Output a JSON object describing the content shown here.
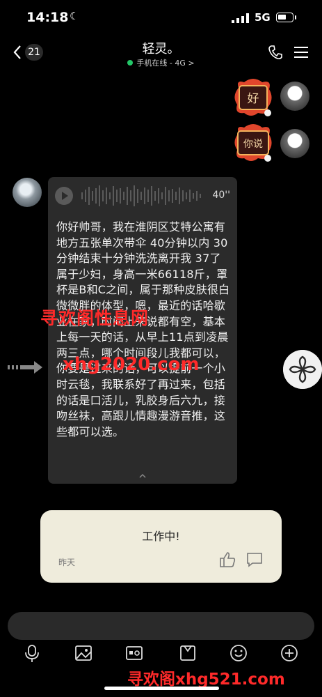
{
  "status": {
    "time": "14:18",
    "network": "5G"
  },
  "header": {
    "unread_count": "21",
    "title": "轻灵。",
    "subtitle": "手机在线 - 4G >"
  },
  "messages": {
    "sticker_1_text": "好",
    "sticker_2_text": "你说",
    "voice_duration": "40''",
    "transcript": "你好帅哥，我在淮阴区艾特公寓有地方五张单次带伞 40分钟以内 30分钟结束十分钟洗洗离开我 37了属于少妇，身高一米66118斤，罩杯是B和C之间，属于那种皮肤很白微微胖的体型，嗯，最近的话哈歇业在家，时间上来说都有空，基本上每一天的话，从早上11点到凌晨两三点，哪个时间段儿我都可以，你要是过来的话，可以提前一个小时云毯，我联系好了再过来，包括的话是口活儿，乳胶身后六九，接吻丝袜，高跟儿情趣漫游音推，这些都可以选。"
  },
  "watermarks": {
    "line1": "寻欢阁性息网",
    "line2": "xhg2020.com",
    "line3": "寻欢阁xhg521.com"
  },
  "status_card": {
    "title": "工作中!",
    "date": "昨天"
  },
  "icons": [
    "back-icon",
    "phone-icon",
    "menu-icon",
    "play-icon",
    "forward-icon",
    "pinwheel-icon",
    "thumbs-up-icon",
    "comment-icon",
    "mic-icon",
    "image-icon",
    "video-icon",
    "folder-icon",
    "emoji-icon",
    "plus-icon"
  ],
  "colors": {
    "online": "#23c768",
    "bubble": "#2b2b2b",
    "card": "#efecdc",
    "watermark": "#ff2a2a"
  }
}
